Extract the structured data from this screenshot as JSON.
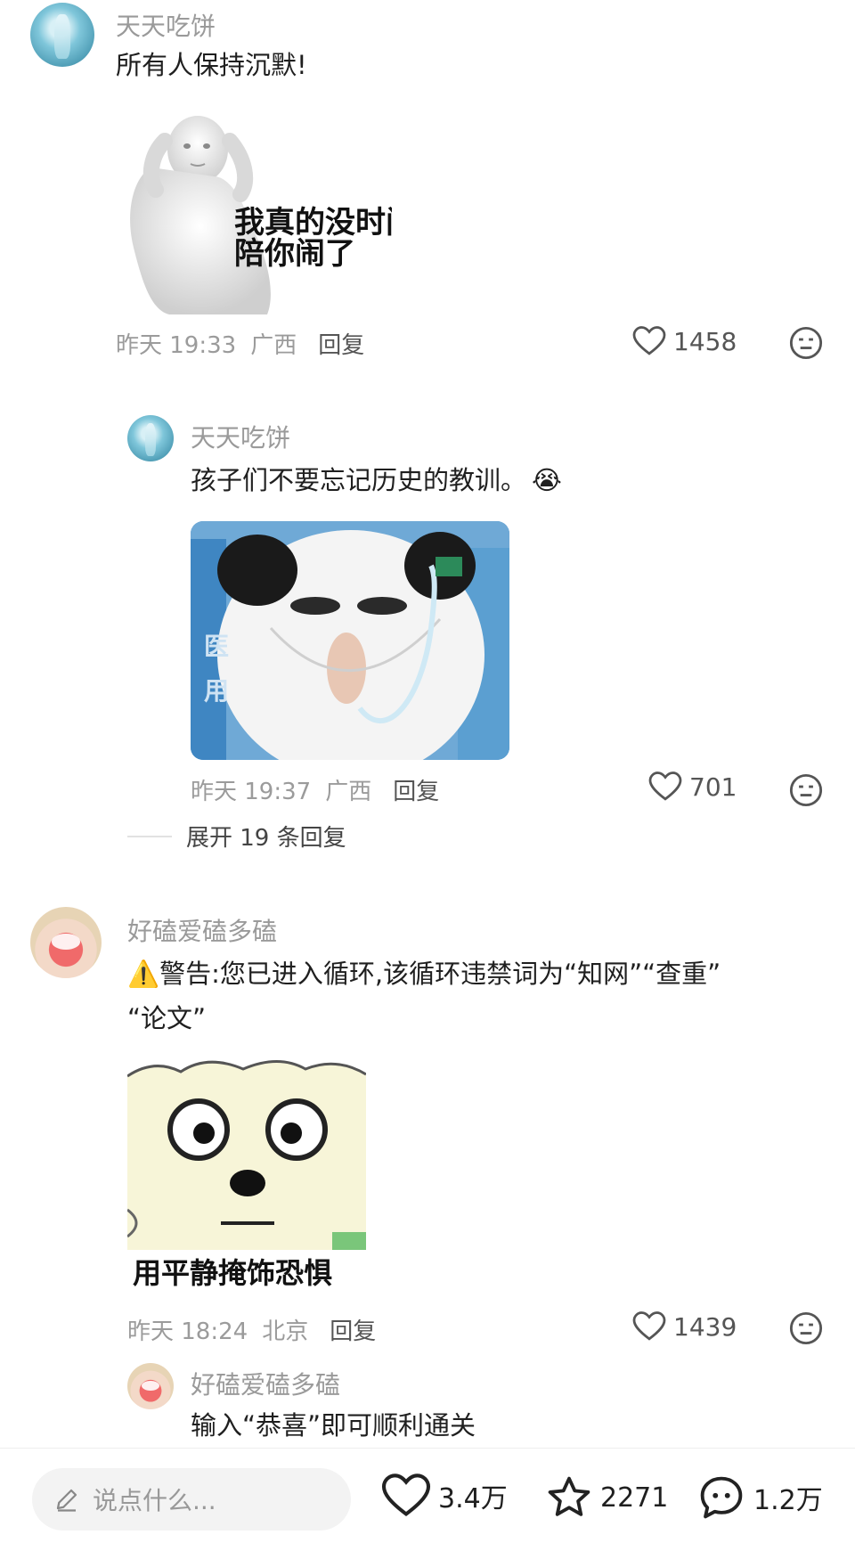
{
  "comments": [
    {
      "user": "天天吃饼",
      "text": "所有人保持沉默!",
      "meme_caption": [
        "我真的没时间",
        "陪你闹了"
      ],
      "time": "昨天 19:33",
      "location": "广西",
      "reply_label": "回复",
      "likes": "1458"
    },
    {
      "user": "天天吃饼",
      "text": "孩子们不要忘记历史的教训。",
      "emoji": "😭",
      "time": "昨天 19:37",
      "location": "广西",
      "reply_label": "回复",
      "likes": "701"
    },
    {
      "user": "好磕爱磕多磕",
      "text_line1": "警告:您已进入循环,该循环违禁词为“知网”“查重”",
      "text_line2": "“论文”",
      "warning_icon": "⚠️",
      "meme_caption": "用平静掩饰恐惧",
      "time": "昨天 18:24",
      "location": "北京",
      "reply_label": "回复",
      "likes": "1439"
    },
    {
      "user": "好磕爱磕多磕",
      "text": "输入“恭喜”即可顺利通关"
    }
  ],
  "expand_replies": "展开 19 条回复",
  "bottom_bar": {
    "input_placeholder": "说点什么...",
    "likes": "3.4万",
    "favorites": "2271",
    "comments": "1.2万"
  },
  "colors": {
    "username": "#9a9a9a",
    "meta": "#9b9b9b",
    "icon": "#555555"
  }
}
